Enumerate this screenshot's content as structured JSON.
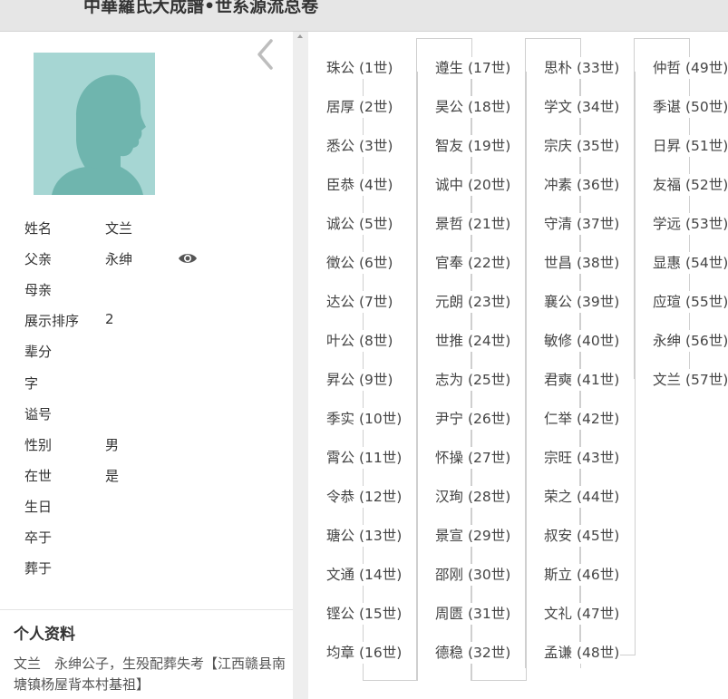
{
  "title": "中華羅氏大成譜•世系源流总卷",
  "person": {
    "fields": [
      {
        "label": "姓名",
        "value": "文兰"
      },
      {
        "label": "父亲",
        "value": "永绅"
      },
      {
        "label": "母亲",
        "value": ""
      },
      {
        "label": "展示排序",
        "value": "2"
      },
      {
        "label": "辈分",
        "value": ""
      },
      {
        "label": "字",
        "value": ""
      },
      {
        "label": "谥号",
        "value": ""
      },
      {
        "label": "性别",
        "value": "男"
      },
      {
        "label": "在世",
        "value": "是"
      },
      {
        "label": "生日",
        "value": ""
      },
      {
        "label": "卒于",
        "value": ""
      },
      {
        "label": "葬于",
        "value": ""
      }
    ],
    "section_title": "个人资料",
    "bio": "文兰　永绅公子，生殁配葬失考【江西赣县南塘镇杨屋背本村基祖】"
  },
  "icons": {
    "back": "chevron-left-icon",
    "eye": "eye-icon",
    "avatar": "person-silhouette-icon"
  },
  "colors": {
    "avatar_bg": "#a6d6d3",
    "avatar_figure": "#6fb5ae"
  },
  "generations": [
    {
      "name": "珠公",
      "gen": "(1世)"
    },
    {
      "name": "居厚",
      "gen": "(2世)"
    },
    {
      "name": "悉公",
      "gen": "(3世)"
    },
    {
      "name": "臣恭",
      "gen": "(4世)"
    },
    {
      "name": "诚公",
      "gen": "(5世)"
    },
    {
      "name": "徵公",
      "gen": "(6世)"
    },
    {
      "name": "达公",
      "gen": "(7世)"
    },
    {
      "name": "叶公",
      "gen": "(8世)"
    },
    {
      "name": "昇公",
      "gen": "(9世)"
    },
    {
      "name": "季实",
      "gen": "(10世)"
    },
    {
      "name": "霄公",
      "gen": "(11世)"
    },
    {
      "name": "令恭",
      "gen": "(12世)"
    },
    {
      "name": "瑭公",
      "gen": "(13世)"
    },
    {
      "name": "文通",
      "gen": "(14世)"
    },
    {
      "name": "铿公",
      "gen": "(15世)"
    },
    {
      "name": "均章",
      "gen": "(16世)"
    },
    {
      "name": "遵生",
      "gen": "(17世)"
    },
    {
      "name": "昊公",
      "gen": "(18世)"
    },
    {
      "name": "智友",
      "gen": "(19世)"
    },
    {
      "name": "诚中",
      "gen": "(20世)"
    },
    {
      "name": "景哲",
      "gen": "(21世)"
    },
    {
      "name": "官奉",
      "gen": "(22世)"
    },
    {
      "name": "元朗",
      "gen": "(23世)"
    },
    {
      "name": "世推",
      "gen": "(24世)"
    },
    {
      "name": "志为",
      "gen": "(25世)"
    },
    {
      "name": "尹宁",
      "gen": "(26世)"
    },
    {
      "name": "怀操",
      "gen": "(27世)"
    },
    {
      "name": "汉珣",
      "gen": "(28世)"
    },
    {
      "name": "景宣",
      "gen": "(29世)"
    },
    {
      "name": "邵刚",
      "gen": "(30世)"
    },
    {
      "name": "周匮",
      "gen": "(31世)"
    },
    {
      "name": "德稳",
      "gen": "(32世)"
    },
    {
      "name": "思朴",
      "gen": "(33世)"
    },
    {
      "name": "学文",
      "gen": "(34世)"
    },
    {
      "name": "宗庆",
      "gen": "(35世)"
    },
    {
      "name": "冲素",
      "gen": "(36世)"
    },
    {
      "name": "守清",
      "gen": "(37世)"
    },
    {
      "name": "世昌",
      "gen": "(38世)"
    },
    {
      "name": "襄公",
      "gen": "(39世)"
    },
    {
      "name": "敏修",
      "gen": "(40世)"
    },
    {
      "name": "君奭",
      "gen": "(41世)"
    },
    {
      "name": "仁举",
      "gen": "(42世)"
    },
    {
      "name": "宗旺",
      "gen": "(43世)"
    },
    {
      "name": "荣之",
      "gen": "(44世)"
    },
    {
      "name": "叔安",
      "gen": "(45世)"
    },
    {
      "name": "斯立",
      "gen": "(46世)"
    },
    {
      "name": "文礼",
      "gen": "(47世)"
    },
    {
      "name": "孟谦",
      "gen": "(48世)"
    },
    {
      "name": "仲哲",
      "gen": "(49世)"
    },
    {
      "name": "季谌",
      "gen": "(50世)"
    },
    {
      "name": "日昇",
      "gen": "(51世)"
    },
    {
      "name": "友福",
      "gen": "(52世)"
    },
    {
      "name": "学远",
      "gen": "(53世)"
    },
    {
      "name": "显惠",
      "gen": "(54世)"
    },
    {
      "name": "应瑄",
      "gen": "(55世)"
    },
    {
      "name": "永绅",
      "gen": "(56世)"
    },
    {
      "name": "文兰",
      "gen": "(57世)"
    }
  ]
}
